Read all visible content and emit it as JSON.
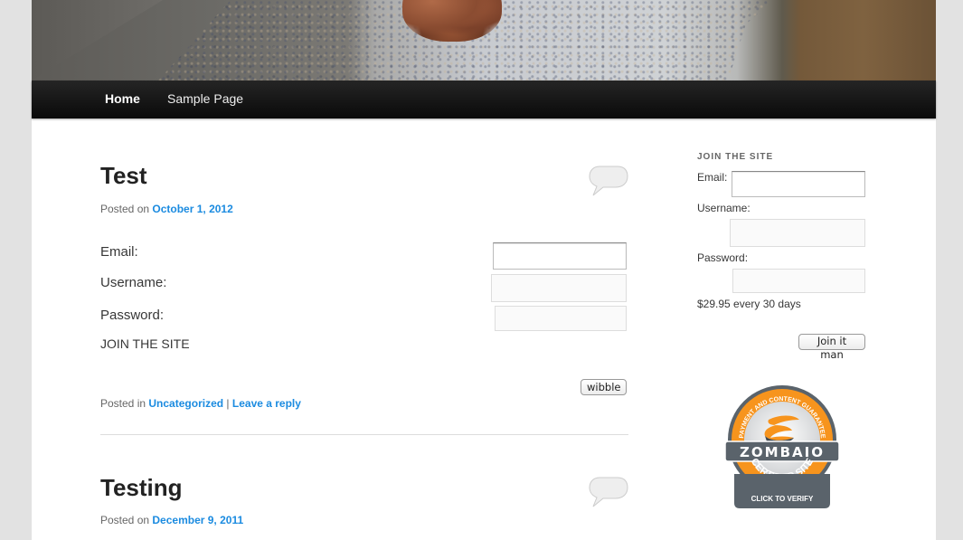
{
  "nav": {
    "items": [
      {
        "label": "Home",
        "current": true
      },
      {
        "label": "Sample Page",
        "current": false
      }
    ]
  },
  "posts": [
    {
      "title": "Test",
      "meta_prefix": "Posted on",
      "date": "October 1, 2012",
      "form": {
        "email_label": "Email:",
        "email_value": "",
        "username_label": "Username:",
        "username_value": "",
        "password_label": "Password:",
        "password_value": "",
        "join_text": "JOIN THE SITE",
        "submit_label": "wibble"
      },
      "footer_prefix": "Posted in",
      "category": "Uncategorized",
      "separator": "|",
      "reply_link": "Leave a reply"
    },
    {
      "title": "Testing",
      "meta_prefix": "Posted on",
      "date": "December 9, 2011"
    }
  ],
  "sidebar": {
    "widget_title": "JOIN THE SITE",
    "email_label": "Email:",
    "email_value": "",
    "username_label": "Username:",
    "username_value": "",
    "password_label": "Password:",
    "password_value": "",
    "price_text": "$29.95 every 30 days",
    "submit_label": "Join it man",
    "badge": {
      "arc_text": "PAYMENT AND CONTENT GUARANTEE",
      "brand": "ZOMBAIO",
      "certified": "CERTIFIED SITE",
      "cta": "CLICK TO VERIFY"
    }
  },
  "colors": {
    "link": "#1b8be0",
    "badge_orange": "#f7941d",
    "badge_gray": "#5a636b"
  }
}
